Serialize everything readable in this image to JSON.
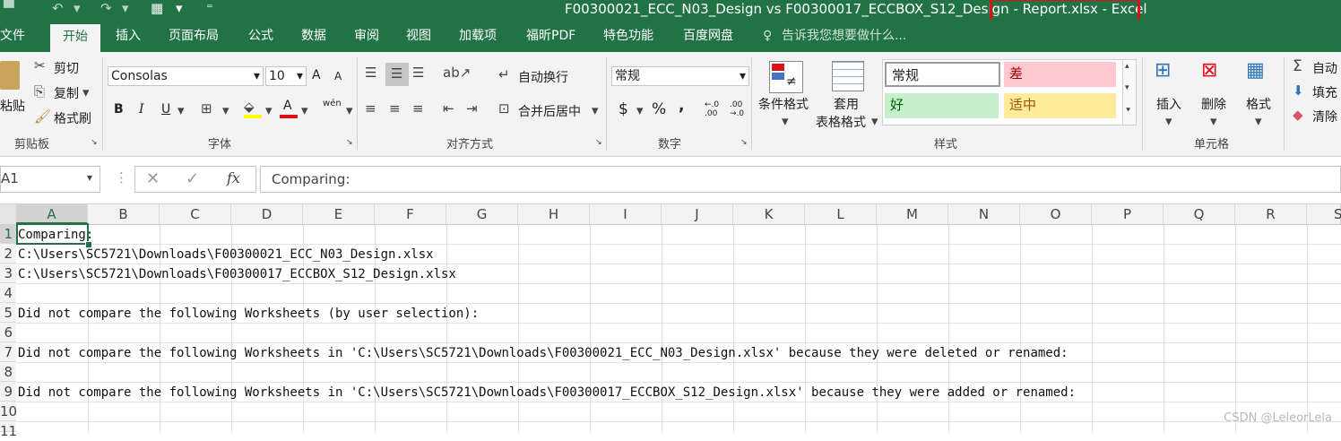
{
  "window": {
    "title_prefix": "F00300021_ECC_N03_Design vs F00300017_ECCBOX_S12_Design ",
    "title_suffix": "- Report.xlsx - Excel"
  },
  "quick_access": {
    "undo_icon": "undo-icon",
    "redo_icon": "redo-icon",
    "form_icon": "form-icon",
    "customize_icon": "chevron-down-icon"
  },
  "tabs": [
    {
      "label": "文件"
    },
    {
      "label": "开始"
    },
    {
      "label": "插入"
    },
    {
      "label": "页面布局"
    },
    {
      "label": "公式"
    },
    {
      "label": "数据"
    },
    {
      "label": "审阅"
    },
    {
      "label": "视图"
    },
    {
      "label": "加载项"
    },
    {
      "label": "福昕PDF"
    },
    {
      "label": "特色功能"
    },
    {
      "label": "百度网盘"
    }
  ],
  "tell_me": "告诉我您想要做什么...",
  "ribbon": {
    "clipboard": {
      "paste": "粘贴",
      "cut": "剪切",
      "copy": "复制",
      "format_painter": "格式刷",
      "label": "剪贴板"
    },
    "font": {
      "name": "Consolas",
      "size": "10",
      "grow": "A",
      "shrink": "A",
      "bold": "B",
      "italic": "I",
      "underline": "U",
      "phonetic": "wén",
      "label": "字体"
    },
    "alignment": {
      "wrap": "自动换行",
      "merge": "合并后居中",
      "label": "对齐方式"
    },
    "number": {
      "format": "常规",
      "currency": "$",
      "percent": "%",
      "comma": ",",
      "inc_decimal": "←.0 .00",
      "dec_decimal": ".00 →.0",
      "label": "数字"
    },
    "styles": {
      "cond_format": "条件格式",
      "table_format_1": "套用",
      "table_format_2": "表格格式",
      "normal": "常规",
      "bad": "差",
      "good": "好",
      "neutral": "适中",
      "label": "样式"
    },
    "cells": {
      "insert": "插入",
      "delete": "删除",
      "format": "格式",
      "label": "单元格"
    },
    "editing": {
      "autosum": "自动",
      "fill": "填充",
      "clear": "清除"
    }
  },
  "formula_bar": {
    "name_box": "A1",
    "fx": "fx",
    "content": "Comparing:"
  },
  "columns": [
    "A",
    "B",
    "C",
    "D",
    "E",
    "F",
    "G",
    "H",
    "I",
    "J",
    "K",
    "L",
    "M",
    "N",
    "O",
    "P",
    "Q",
    "R",
    "S"
  ],
  "rows": [
    "1",
    "2",
    "3",
    "4",
    "5",
    "6",
    "7",
    "8",
    "9",
    "10",
    "11"
  ],
  "cells": {
    "A1": "Comparing:",
    "A2": "C:\\Users\\SC5721\\Downloads\\F00300021_ECC_N03_Design.xlsx",
    "A3": "C:\\Users\\SC5721\\Downloads\\F00300017_ECCBOX_S12_Design.xlsx",
    "A5": "Did not compare the following Worksheets (by user selection):",
    "A7": "Did not compare the following Worksheets in 'C:\\Users\\SC5721\\Downloads\\F00300021_ECC_N03_Design.xlsx' because they were deleted or renamed:",
    "A9": "Did not compare the following Worksheets in 'C:\\Users\\SC5721\\Downloads\\F00300017_ECCBOX_S12_Design.xlsx' because they were added or renamed:"
  },
  "watermark": "CSDN @LeleorLela",
  "colors": {
    "excel_green": "#217346",
    "highlight_red": "#e0101a",
    "bad_bg": "#ffc7ce",
    "good_bg": "#c6efce",
    "neutral_bg": "#ffeb9c"
  }
}
